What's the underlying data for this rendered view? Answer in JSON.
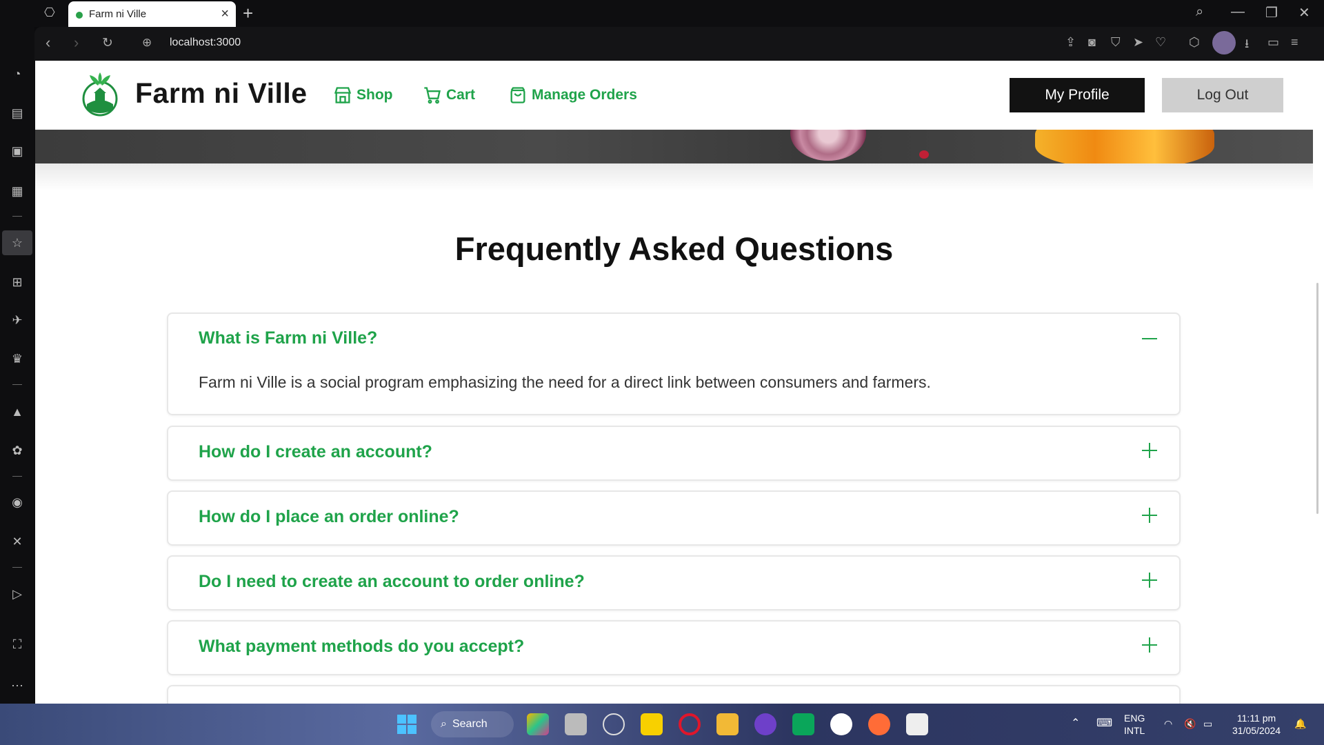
{
  "browser": {
    "tab_title": "Farm ni Ville",
    "url": "localhost:3000"
  },
  "header": {
    "brand": "Farm ni Ville",
    "nav": [
      {
        "label": "Shop",
        "icon": "store-icon"
      },
      {
        "label": "Cart",
        "icon": "cart-icon"
      },
      {
        "label": "Manage Orders",
        "icon": "bag-icon"
      }
    ],
    "profile_label": "My Profile",
    "logout_label": "Log Out"
  },
  "faq": {
    "title": "Frequently Asked Questions",
    "items": [
      {
        "question": "What is Farm ni Ville?",
        "answer": "Farm ni Ville is a social program emphasizing the need for a direct link between consumers and farmers.",
        "expanded": true
      },
      {
        "question": "How do I create an account?",
        "expanded": false
      },
      {
        "question": "How do I place an order online?",
        "expanded": false
      },
      {
        "question": "Do I need to create an account to order online?",
        "expanded": false
      },
      {
        "question": "What payment methods do you accept?",
        "expanded": false
      }
    ]
  },
  "taskbar": {
    "search_label": "Search",
    "lang": "ENG",
    "lang_sub": "INTL",
    "time": "11:11 pm",
    "date": "31/05/2024"
  },
  "colors": {
    "accent_green": "#1fa34a",
    "dark": "#121212"
  }
}
